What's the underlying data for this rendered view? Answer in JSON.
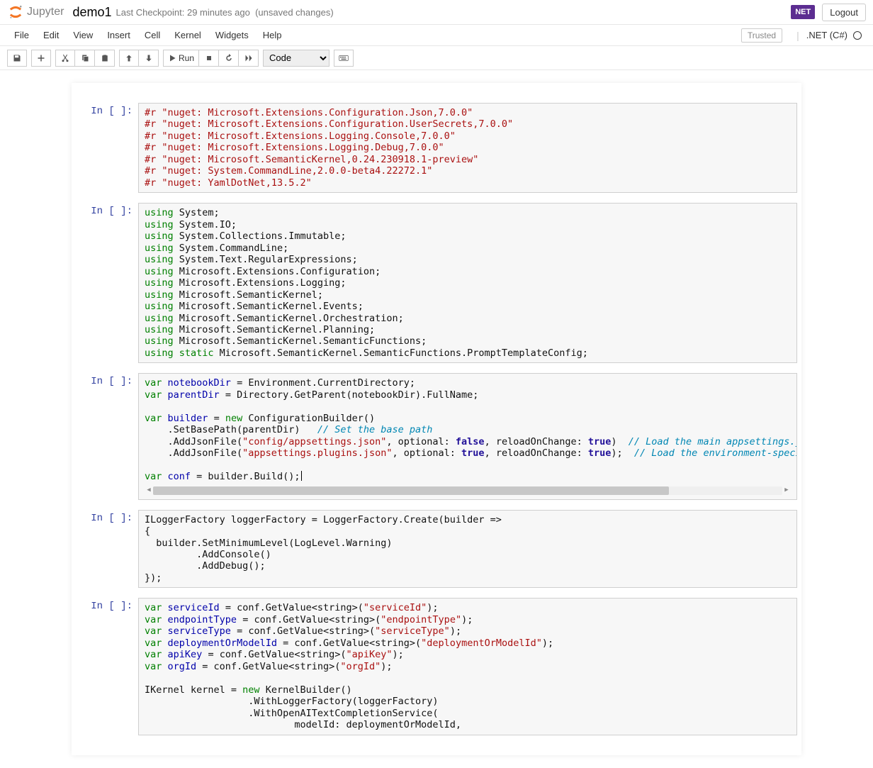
{
  "header": {
    "logo_text": "Jupyter",
    "notebook_name": "demo1",
    "checkpoint": "Last Checkpoint: 29 minutes ago",
    "unsaved": "(unsaved changes)",
    "net_badge": "NET",
    "logout": "Logout"
  },
  "menu": {
    "items": [
      "File",
      "Edit",
      "View",
      "Insert",
      "Cell",
      "Kernel",
      "Widgets",
      "Help"
    ],
    "trusted": "Trusted",
    "kernel_name": ".NET (C#)"
  },
  "toolbar": {
    "run_label": "Run",
    "cell_type": "Code"
  },
  "prompts": {
    "in_empty": "In [ ]:"
  },
  "cells": {
    "c0": {
      "l0_a": "#r ",
      "l0_b": "\"nuget: Microsoft.Extensions.Configuration.Json,7.0.0\"",
      "l1_a": "#r ",
      "l1_b": "\"nuget: Microsoft.Extensions.Configuration.UserSecrets,7.0.0\"",
      "l2_a": "#r ",
      "l2_b": "\"nuget: Microsoft.Extensions.Logging.Console,7.0.0\"",
      "l3_a": "#r ",
      "l3_b": "\"nuget: Microsoft.Extensions.Logging.Debug,7.0.0\"",
      "l4_a": "#r ",
      "l4_b": "\"nuget: Microsoft.SemanticKernel,0.24.230918.1-preview\"",
      "l5_a": "#r ",
      "l5_b": "\"nuget: System.CommandLine,2.0.0-beta4.22272.1\"",
      "l6_a": "#r ",
      "l6_b": "\"nuget: YamlDotNet,13.5.2\""
    },
    "c1": {
      "kw": "using",
      "kws": "using static",
      "l0": " System;",
      "l1": " System.IO;",
      "l2": " System.Collections.Immutable;",
      "l3": " System.CommandLine;",
      "l4": " System.Text.RegularExpressions;",
      "l5": " Microsoft.Extensions.Configuration;",
      "l6": " Microsoft.Extensions.Logging;",
      "l7": " Microsoft.SemanticKernel;",
      "l8": " Microsoft.SemanticKernel.Events;",
      "l9": " Microsoft.SemanticKernel.Orchestration;",
      "l10": " Microsoft.SemanticKernel.Planning;",
      "l11": " Microsoft.SemanticKernel.SemanticFunctions;",
      "l12": " Microsoft.SemanticKernel.SemanticFunctions.PromptTemplateConfig;"
    },
    "c2": {
      "var": "var",
      "new": "new",
      "true": "true",
      "false": "false",
      "nb_name": "notebookDir",
      "nb_rest": " = Environment.CurrentDirectory;",
      "pd_name": "parentDir",
      "pd_rest": " = Directory.GetParent(notebookDir).FullName;",
      "bld_name": "builder",
      "bld_eq": " = ",
      "bld_call": " ConfigurationBuilder()",
      "sbp": "    .SetBasePath(parentDir)   ",
      "sbp_c": "// Set the base path",
      "aj1_a": "    .AddJsonFile(",
      "aj1_s": "\"config/appsettings.json\"",
      "aj1_b": ", optional: ",
      "aj1_c": ", reloadOnChange: ",
      "aj1_d": ")  ",
      "aj1_cc": "// Load the main appsettings.json file",
      "aj2_a": "    .AddJsonFile(",
      "aj2_s": "\"appsettings.plugins.json\"",
      "aj2_b": ", optional: ",
      "aj2_c": ", reloadOnChange: ",
      "aj2_d": ");  ",
      "aj2_cc": "// Load the environment-specific appsettings",
      "conf_name": "conf",
      "conf_rest": " = builder.Build();"
    },
    "c3": {
      "l0": "ILoggerFactory loggerFactory = LoggerFactory.Create(builder =>",
      "l1": "{",
      "l2": "  builder.SetMinimumLevel(LogLevel.Warning)",
      "l3": "         .AddConsole()",
      "l4": "         .AddDebug();",
      "l5": "});"
    },
    "c4": {
      "var": "var",
      "new": "new",
      "sid_name": "serviceId",
      "sid_mid": " = conf.GetValue<string>(",
      "sid_s": "\"serviceId\"",
      "sid_end": ");",
      "ept_name": "endpointType",
      "ept_mid": " = conf.GetValue<string>(",
      "ept_s": "\"endpointType\"",
      "ept_end": ");",
      "svt_name": "serviceType",
      "svt_mid": " = conf.GetValue<string>(",
      "svt_s": "\"serviceType\"",
      "svt_end": ");",
      "dom_name": "deploymentOrModelId",
      "dom_mid": " = conf.GetValue<string>(",
      "dom_s": "\"deploymentOrModelId\"",
      "dom_end": ");",
      "apk_name": "apiKey",
      "apk_mid": " = conf.GetValue<string>(",
      "apk_s": "\"apiKey\"",
      "apk_end": ");",
      "org_name": "orgId",
      "org_mid": " = conf.GetValue<string>(",
      "org_s": "\"orgId\"",
      "org_end": ");",
      "ikr_a": "IKernel kernel = ",
      "ikr_b": " KernelBuilder()",
      "wlf": "                  .WithLoggerFactory(loggerFactory)",
      "wos": "                  .WithOpenAITextCompletionService(",
      "mid": "                          modelId: deploymentOrModelId,"
    }
  }
}
